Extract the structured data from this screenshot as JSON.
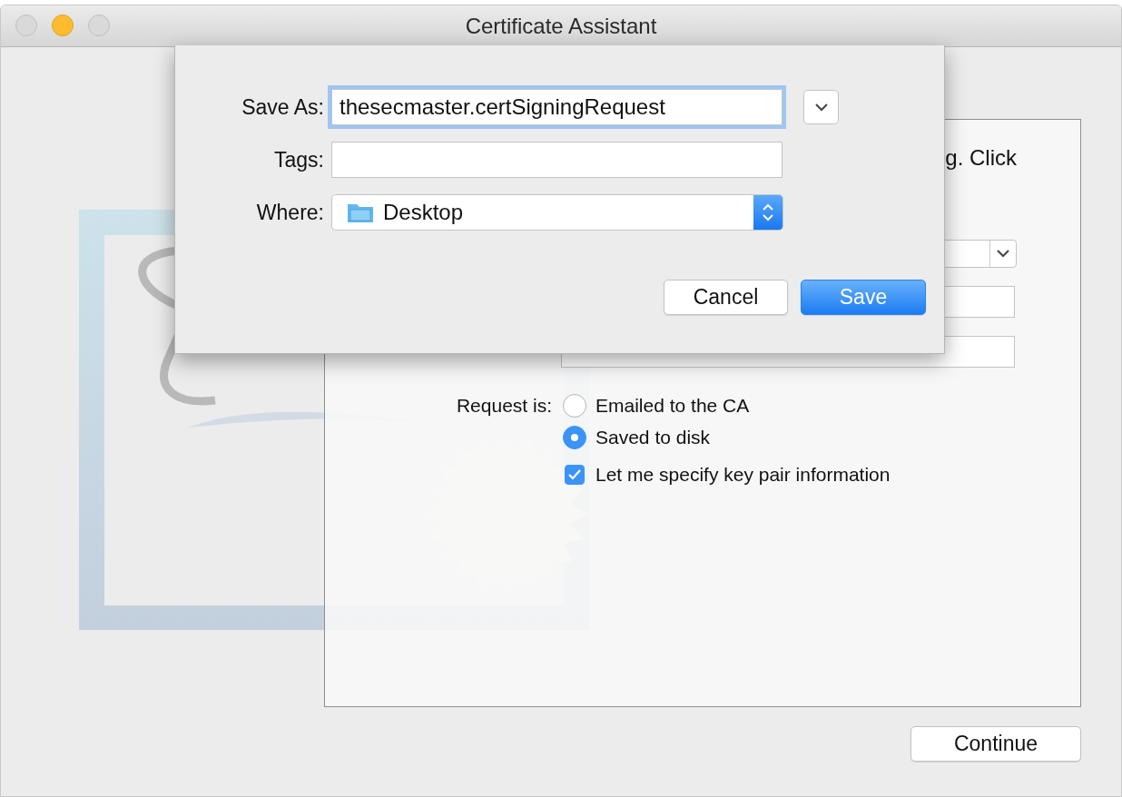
{
  "window": {
    "title": "Certificate Assistant"
  },
  "assistant": {
    "intro_text": "g. Click",
    "request_label": "Request is:",
    "request_options": [
      {
        "label": "Emailed to the CA",
        "selected": false
      },
      {
        "label": "Saved to disk",
        "selected": true
      }
    ],
    "key_pair_option": {
      "label": "Let me specify key pair information",
      "checked": true
    },
    "continue_button": "Continue"
  },
  "save_sheet": {
    "save_as_label": "Save As:",
    "save_as_value": "thesecmaster.certSigningRequest",
    "tags_label": "Tags:",
    "where_label": "Where:",
    "where_value": "Desktop",
    "buttons": [
      {
        "label": "Cancel",
        "kind": "normal"
      },
      {
        "label": "Save",
        "kind": "default"
      }
    ]
  }
}
